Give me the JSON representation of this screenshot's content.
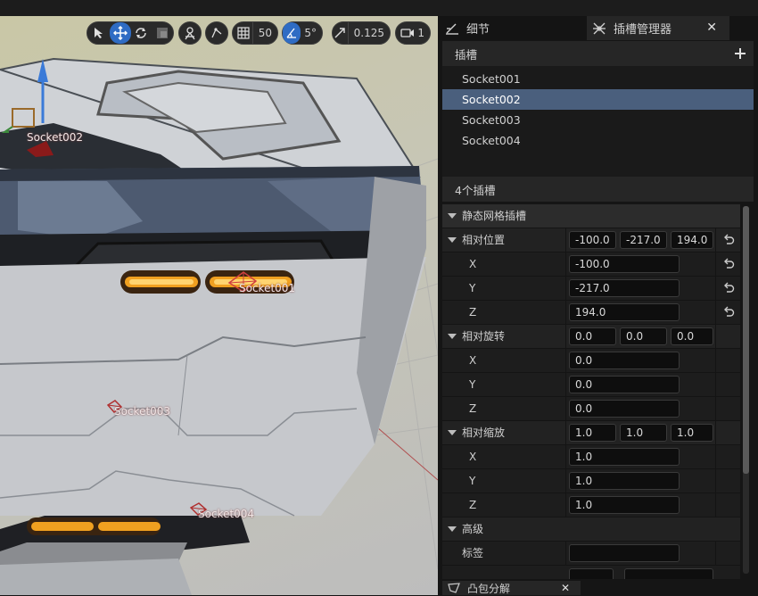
{
  "viewport_toolbar": {
    "grid_snap_value": "50",
    "rotation_snap_value": "5°",
    "scale_snap_value": "0.125",
    "camera_speed_value": "1"
  },
  "viewport_labels": {
    "socket001": "Socket001",
    "socket002": "Socket002",
    "socket003": "Socket003",
    "socket004": "Socket004"
  },
  "tabs": {
    "details": "细节",
    "socket_manager": "插槽管理器"
  },
  "sockets": {
    "header": "插槽",
    "items": [
      "Socket001",
      "Socket002",
      "Socket003",
      "Socket004"
    ],
    "selected_index": 1,
    "count_text": "4个插槽"
  },
  "details": {
    "category": "静态网格插槽",
    "location": {
      "label": "相对位置",
      "x": "-100.0",
      "y": "-217.0",
      "z": "194.0"
    },
    "rotation": {
      "label": "相对旋转",
      "x": "0.0",
      "y": "0.0",
      "z": "0.0"
    },
    "scale": {
      "label": "相对缩放",
      "x": "1.0",
      "y": "1.0",
      "z": "1.0"
    },
    "axis": {
      "x": "X",
      "y": "Y",
      "z": "Z"
    },
    "advanced": "高级",
    "tag_label": "标签"
  },
  "bottom_tab": "凸包分解",
  "colors": {
    "accent": "#2f6cc4",
    "selection": "#4a5f7d",
    "panel_bg": "#1a1a1a"
  },
  "icons": [
    "select-icon",
    "translate-icon",
    "rotate-icon",
    "scale-icon",
    "local-space-icon",
    "surface-snap-icon",
    "grid-snap-icon",
    "rotation-snap-icon",
    "scale-snap-icon",
    "camera-speed-icon",
    "details-pencil-icon",
    "socket-manager-icon",
    "close-icon",
    "add-icon",
    "reset-arrow-icon",
    "expand-arrow-icon"
  ]
}
